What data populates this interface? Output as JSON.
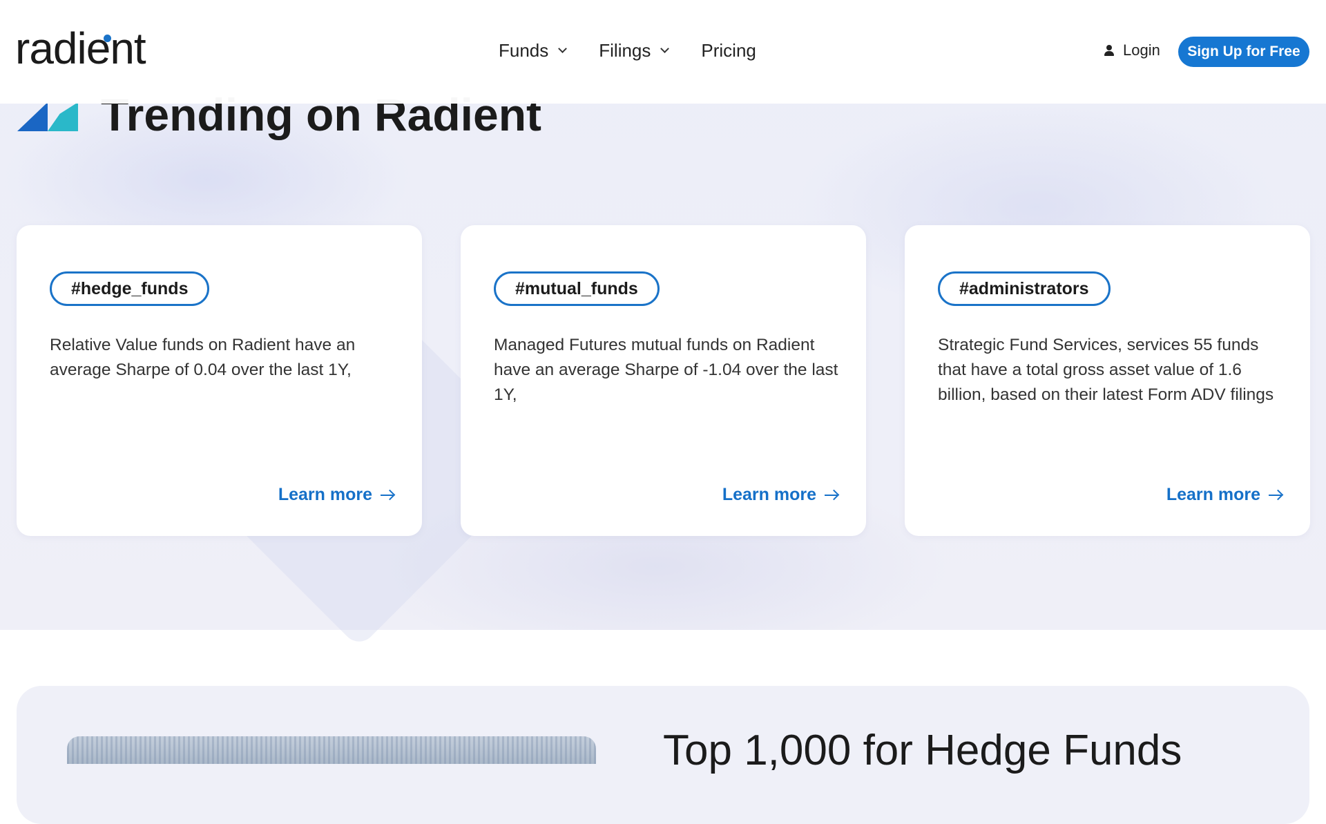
{
  "header": {
    "logo": "radient",
    "nav": [
      {
        "label": "Funds",
        "has_dropdown": true
      },
      {
        "label": "Filings",
        "has_dropdown": true
      },
      {
        "label": "Pricing",
        "has_dropdown": false
      }
    ],
    "login_label": "Login",
    "signup_label": "Sign Up for Free"
  },
  "trending": {
    "title": "Trending on Radient",
    "cards": [
      {
        "tag": "#hedge_funds",
        "text": "Relative Value funds on Radient have an average Sharpe of 0.04 over the last 1Y,",
        "link": "Learn more"
      },
      {
        "tag": "#mutual_funds",
        "text": "Managed Futures mutual funds on Radient have an average Sharpe of -1.04 over the last 1Y,",
        "link": "Learn more"
      },
      {
        "tag": "#administrators",
        "text": "Strategic Fund Services, services 55 funds that have a total gross asset value of 1.6 billion, based on their latest Form ADV filings",
        "link": "Learn more"
      }
    ]
  },
  "promo": {
    "title_partial": "Top 1,000 for Hedge Funds"
  },
  "colors": {
    "accent": "#1677d2",
    "link": "#1570c8",
    "tag_border": "#1a73c8",
    "band_background": "#eceef8"
  }
}
